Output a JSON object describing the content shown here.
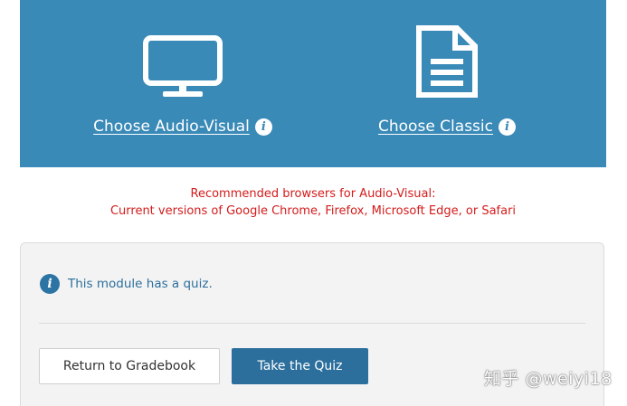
{
  "choose": {
    "audio_visual": {
      "label": "Choose Audio-Visual",
      "icon": "monitor-icon",
      "info_glyph": "i"
    },
    "classic": {
      "label": "Choose Classic",
      "icon": "document-icon",
      "info_glyph": "i"
    }
  },
  "browser_note": {
    "line1": "Recommended browsers for Audio-Visual:",
    "line2": "Current versions of Google Chrome, Firefox, Microsoft Edge, or Safari"
  },
  "quiz": {
    "info_glyph": "i",
    "info_text": "This module has a quiz.",
    "return_label": "Return to Gradebook",
    "take_quiz_label": "Take the Quiz"
  },
  "watermark": "知乎 @weiyi18",
  "colors": {
    "panel_blue": "#3a8ab8",
    "button_blue": "#2c6f9d",
    "notice_red": "#d41b1b",
    "quiz_bg": "#f3f3f3"
  }
}
